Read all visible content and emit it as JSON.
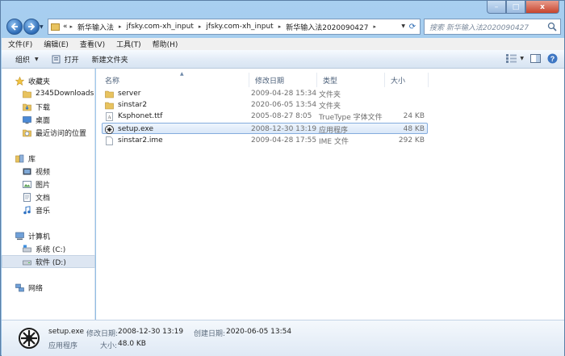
{
  "window": {
    "minimize": "–",
    "maximize": "□",
    "close": "x"
  },
  "address": {
    "overflow": "«",
    "crumbs": [
      "新华输入法",
      "jfsky.com-xh_input",
      "jfsky.com-xh_input",
      "新华输入法2020090427"
    ],
    "search_placeholder": "搜索 新华输入法2020090427"
  },
  "menu": {
    "items": [
      "文件(F)",
      "编辑(E)",
      "查看(V)",
      "工具(T)",
      "帮助(H)"
    ]
  },
  "toolbar": {
    "organize": "组织",
    "open": "打开",
    "new_folder": "新建文件夹"
  },
  "sidebar": {
    "favorites": "收藏夹",
    "fav_items": [
      "2345Downloads",
      "下载",
      "桌面",
      "最近访问的位置"
    ],
    "libraries": "库",
    "lib_items": [
      "视频",
      "图片",
      "文档",
      "音乐"
    ],
    "computer": "计算机",
    "drives": [
      "系统 (C:)",
      "软件 (D:)"
    ],
    "network": "网络"
  },
  "columns": {
    "name": "名称",
    "date": "修改日期",
    "type": "类型",
    "size": "大小"
  },
  "files": [
    {
      "name": "server",
      "date": "2009-04-28 15:34",
      "type": "文件夹",
      "size": "",
      "icon": "folder-icon"
    },
    {
      "name": "sinstar2",
      "date": "2020-06-05 13:54",
      "type": "文件夹",
      "size": "",
      "icon": "folder-icon"
    },
    {
      "name": "Ksphonet.ttf",
      "date": "2005-08-27 8:05",
      "type": "TrueType 字体文件",
      "size": "24 KB",
      "icon": "font-file-icon"
    },
    {
      "name": "setup.exe",
      "date": "2008-12-30 13:19",
      "type": "应用程序",
      "size": "48 KB",
      "icon": "setup-exe-icon"
    },
    {
      "name": "sinstar2.ime",
      "date": "2009-04-28 17:55",
      "type": "IME 文件",
      "size": "292 KB",
      "icon": "file-icon"
    }
  ],
  "details": {
    "filename": "setup.exe",
    "modified_label": "修改日期:",
    "modified_value": "2008-12-30 13:19",
    "created_label": "创建日期:",
    "created_value": "2020-06-05 13:54",
    "filetype": "应用程序",
    "size_label": "大小:",
    "size_value": "48.0 KB"
  },
  "colors": {
    "selection_border": "#84acdd",
    "selection_fill": "#d9e7f8",
    "folder": "#e8c35f",
    "frame": "#a8cff0"
  }
}
